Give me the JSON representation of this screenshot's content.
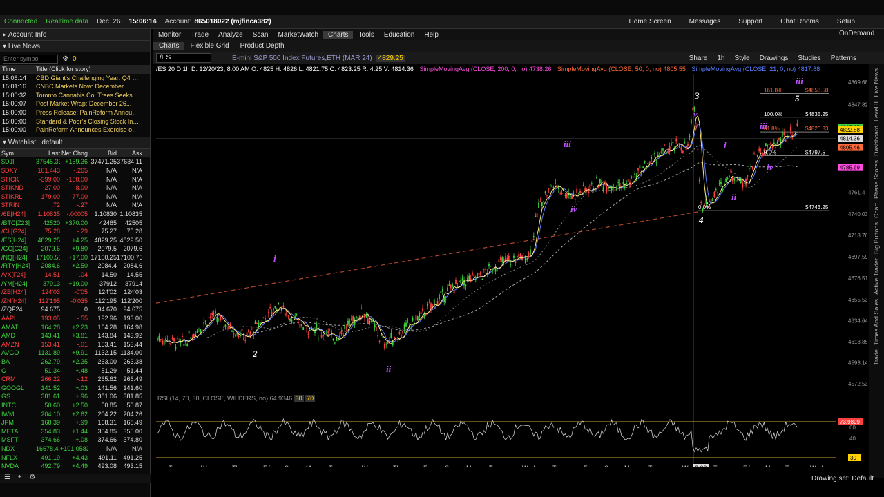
{
  "topbar": {
    "connected": "Connected",
    "realtime": "Realtime data",
    "date": "Dec. 26",
    "time": "15:06:14",
    "account_label": "Account:",
    "account": "865018022 (mjfinca382)",
    "home": "Home Screen",
    "messages": "Messages",
    "support": "Support",
    "chat": "Chat Rooms",
    "setup": "Setup"
  },
  "left": {
    "account_info": "Account Info",
    "live_news": "Live News",
    "symbol_placeholder": "Enter symbol",
    "news_count": "0",
    "news_cols": [
      "Time",
      "Title (Click for story)"
    ],
    "news": [
      [
        "15:06:14",
        "CBD Giant's Challenging Year: Q4 N..."
      ],
      [
        "15:01:16",
        "CNBC Markets Now: December ..."
      ],
      [
        "15:00:32",
        "Toronto Cannabis Co. Trees Seeks ..."
      ],
      [
        "15:00:07",
        "Post Market Wrap: December 26..."
      ],
      [
        "15:00:00",
        "Press Release: PainReform Announ..."
      ],
      [
        "15:00:00",
        "Standard & Poor's Closing Stock Ind..."
      ],
      [
        "15:00:00",
        "PainReform Announces Exercise of ..."
      ]
    ],
    "watchlist_label": "Watchlist",
    "watchlist_name": "default",
    "wl_cols": [
      "Sym...",
      "Last",
      "Net Chng",
      "Bid",
      "Ask"
    ],
    "wl": [
      [
        "$DJI",
        "37545.33",
        "+159.36",
        "37471.25",
        "37634.11",
        "up"
      ],
      [
        "$DXY",
        "101.443",
        "-.265",
        "N/A",
        "N/A",
        "dn"
      ],
      [
        "$TICK",
        "-399.00",
        "-180.00",
        "N/A",
        "N/A",
        "dn"
      ],
      [
        "$TIKND",
        "-27.00",
        "-8.00",
        "N/A",
        "N/A",
        "dn"
      ],
      [
        "$TIKRL",
        "-179.00",
        "-77.00",
        "N/A",
        "N/A",
        "dn"
      ],
      [
        "$TRIN",
        ".72",
        "-.27",
        "N/A",
        "N/A",
        "dn"
      ],
      [
        "/6E[H24]",
        "1.10835",
        "-.00005",
        "1.10830",
        "1.10835",
        "dn"
      ],
      [
        "/BTC[Z23]",
        "42520",
        "+370.00",
        "42465",
        "42505",
        "up"
      ],
      [
        "/CL[G24]",
        "75.28",
        "-.29",
        "75.27",
        "75.28",
        "dn"
      ],
      [
        "/ES[H24]",
        "4829.25",
        "+4.25",
        "4829.25",
        "4829.50",
        "up"
      ],
      [
        "/GC[G24]",
        "2079.6",
        "+9.80",
        "2079.5",
        "2079.6",
        "up"
      ],
      [
        "/NQ[H24]",
        "17100.50",
        "+17.00",
        "17100.25",
        "17100.75",
        "up"
      ],
      [
        "/RTY[H24]",
        "2084.6",
        "+2.50",
        "2084.4",
        "2084.6",
        "up"
      ],
      [
        "/VX[F24]",
        "14.51",
        "-.04",
        "14.50",
        "14.55",
        "dn"
      ],
      [
        "/YM[H24]",
        "37913",
        "+19.00",
        "37912",
        "37914",
        "up"
      ],
      [
        "/ZB[H24]",
        "124'03",
        "-0'05",
        "124'02",
        "124'03",
        "dn"
      ],
      [
        "/ZN[H24]",
        "112'195",
        "-0'035",
        "112'195",
        "112'200",
        "dn"
      ],
      [
        "/ZQF24",
        "94.675",
        "0",
        "94.670",
        "94.675",
        "ne"
      ],
      [
        "AAPL",
        "193.05",
        "-.55",
        "192.96",
        "193.00",
        "dn"
      ],
      [
        "AMAT",
        "164.28",
        "+2.23",
        "164.28",
        "164.98",
        "up"
      ],
      [
        "AMD",
        "143.41",
        "+3.81",
        "143.84",
        "143.92",
        "up"
      ],
      [
        "AMZN",
        "153.41",
        "-.01",
        "153.41",
        "153.44",
        "dn"
      ],
      [
        "AVGO",
        "1131.89",
        "+9.91",
        "1132.15",
        "1134.00",
        "up"
      ],
      [
        "BA",
        "262.79",
        "+2.35",
        "263.00",
        "263.38",
        "up"
      ],
      [
        "C",
        "51.34",
        "+.48",
        "51.29",
        "51.44",
        "up"
      ],
      [
        "CRM",
        "266.22",
        "-.12",
        "265.62",
        "266.49",
        "dn"
      ],
      [
        "GOOGL",
        "141.52",
        "+.03",
        "141.56",
        "141.60",
        "up"
      ],
      [
        "GS",
        "381.61",
        "+.96",
        "381.06",
        "381.85",
        "up"
      ],
      [
        "INTC",
        "50.60",
        "+2.50",
        "50.85",
        "50.87",
        "up"
      ],
      [
        "IWM",
        "204.10",
        "+2.62",
        "204.22",
        "204.26",
        "up"
      ],
      [
        "JPM",
        "168.39",
        "+.99",
        "168.31",
        "168.49",
        "up"
      ],
      [
        "META",
        "354.83",
        "+1.44",
        "354.85",
        "355.00",
        "up"
      ],
      [
        "MSFT",
        "374.66",
        "+.08",
        "374.66",
        "374.80",
        "up"
      ],
      [
        "NDX",
        "16678.4...",
        "+101.0583",
        "N/A",
        "N/A",
        "up"
      ],
      [
        "NFLX",
        "491.19",
        "+4.43",
        "491.11",
        "491.25",
        "up"
      ],
      [
        "NVDA",
        "492.79",
        "+4.49",
        "493.08",
        "493.15",
        "up"
      ]
    ]
  },
  "menu": [
    "Monitor",
    "Trade",
    "Analyze",
    "Scan",
    "MarketWatch",
    "Charts",
    "Tools",
    "Education",
    "Help"
  ],
  "menu_active": "Charts",
  "ondemand": "OnDemand",
  "subtabs": [
    "Charts",
    "Flexible Grid",
    "Product Depth"
  ],
  "chartbar": {
    "symbol": "/ES",
    "desc": "E-mini S&P 500 Index Futures,ETH (MAR 24)",
    "price": "4829.25",
    "share": "Share",
    "timeframe": "1h",
    "style": "Style",
    "drawings": "Drawings",
    "studies": "Studies",
    "patterns": "Patterns"
  },
  "studyline": {
    "header": "/ES 20 D 1h  D: 12/20/23, 8:00 AM  O: 4825  H: 4826  L: 4821.75  C: 4823.25  R: 4.25  V: 4814.36",
    "sma200": "SimpleMovingAvg (CLOSE, 200, 0, no)  4738.26",
    "sma50": "SimpleMovingAvg (CLOSE, 50, 0, no)  4805.55",
    "sma21": "SimpleMovingAvg (CLOSE, 21, 0, no)  4817.88"
  },
  "rsi_label": "RSI (14, 70, 30, CLOSE, WILDERS, no)  64.9346",
  "rsi_levels": [
    "30",
    "70"
  ],
  "rsi_value": "73.9899",
  "rsi_axis": [
    "60",
    "40",
    "30"
  ],
  "price_axis": [
    "4869.68",
    "4847.82",
    "4825.25",
    "4822.88",
    "4814.36",
    "4805.46",
    "4785.69",
    "4761.4",
    "4740.03",
    "4718.76",
    "4697.59",
    "4676.51",
    "4655.53",
    "4634.64",
    "4613.85",
    "4593.14",
    "4572.53"
  ],
  "fib": [
    [
      "161.8%",
      "$4858.58"
    ],
    [
      "100.0%",
      "$4835.25"
    ],
    [
      "61.8%",
      "$4820.83"
    ],
    [
      "0.0%",
      "$4797.5"
    ],
    [
      "0.0%",
      "$4743.25"
    ]
  ],
  "waves": [
    "3",
    "4",
    "5",
    "2",
    "i",
    "iii",
    "iv",
    "ii",
    "i",
    "ii",
    "iii",
    "iv",
    "iii",
    "v"
  ],
  "time_axis": [
    "Tue",
    "Wed",
    "Thu",
    "Fri",
    "Sun",
    "Mon",
    "Tue",
    "Wed",
    "Thu",
    "Fri",
    "Sun",
    "Mon",
    "Tue",
    "Wed",
    "Thu",
    "Fri",
    "Sun",
    "Mon",
    "Tue",
    "Wed",
    "8:00",
    "Thu",
    "Fri",
    "Mon",
    "Tue",
    "Wed"
  ],
  "right_tabs": [
    "Trade",
    "Times And Sales",
    "Active Trader",
    "Big Buttons",
    "Chart",
    "Phase Scores",
    "Dashboard",
    "Level II",
    "Live News"
  ],
  "drawing_set": "Drawing set: Default",
  "colors": {
    "up": "#3fd13f",
    "down": "#ff4040",
    "accent": "#ffd200"
  }
}
